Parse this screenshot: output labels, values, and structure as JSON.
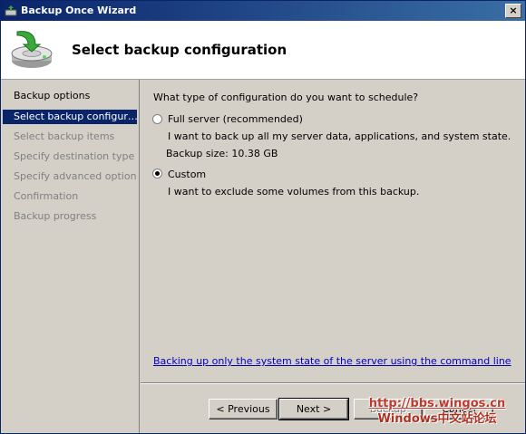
{
  "window": {
    "title": "Backup Once Wizard",
    "close_glyph": "×"
  },
  "header": {
    "title": "Select backup configuration",
    "icon": "backup-disk-icon"
  },
  "nav": {
    "heading": "Backup options",
    "items": [
      {
        "label": "Select backup configur…",
        "active": true
      },
      {
        "label": "Select backup items",
        "active": false
      },
      {
        "label": "Specify destination type",
        "active": false
      },
      {
        "label": "Specify advanced option",
        "active": false
      },
      {
        "label": "Confirmation",
        "active": false
      },
      {
        "label": "Backup progress",
        "active": false
      }
    ]
  },
  "content": {
    "question": "What type of configuration do you want to schedule?",
    "options": [
      {
        "label": "Full server (recommended)",
        "description": "I want to back up all my server data, applications, and system state.",
        "extra": "Backup size: 10.38 GB",
        "selected": false
      },
      {
        "label": "Custom",
        "description": "I want to exclude some volumes from this backup.",
        "selected": true
      }
    ],
    "command_link": "Backing up only the system state of the server using the command line"
  },
  "buttons": {
    "previous": "< Previous",
    "next": "Next >",
    "backup": "Backup",
    "cancel": "Cancel"
  },
  "watermark": {
    "line1": "http://bbs.wingos.cn",
    "line2": "Windows中文站论坛"
  },
  "colors": {
    "selection": "#0a246a",
    "link": "#0000c0",
    "watermark": "#c0392b"
  }
}
